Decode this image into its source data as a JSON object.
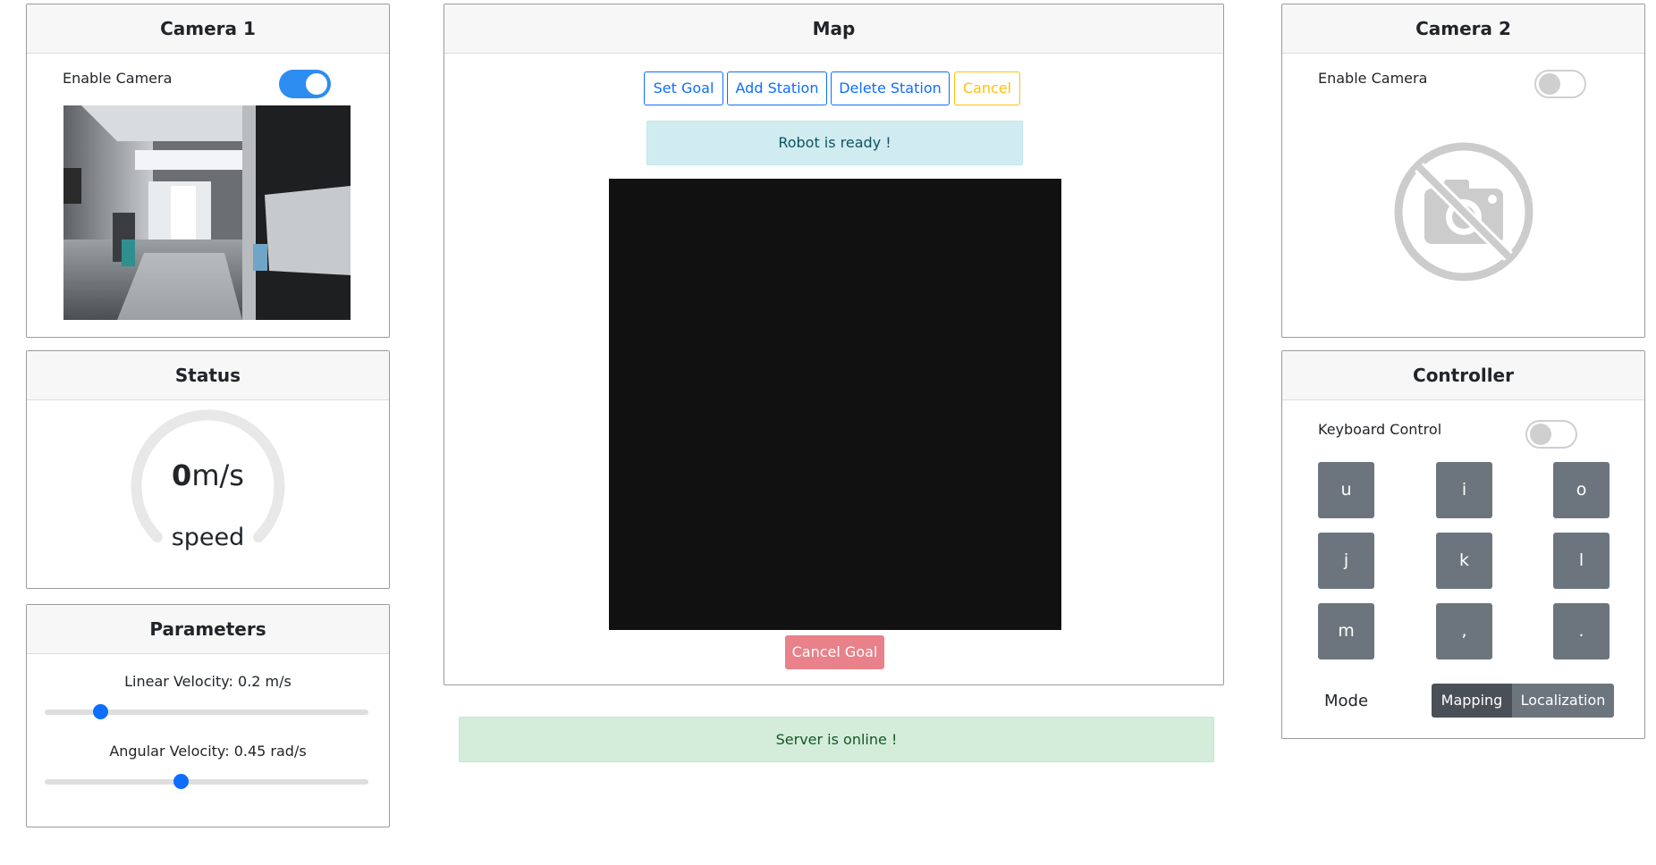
{
  "camera1": {
    "title": "Camera 1",
    "enable_label": "Enable Camera",
    "enabled": true
  },
  "status": {
    "title": "Status",
    "speed_value": "0",
    "speed_unit": "m/s",
    "speed_label": "speed"
  },
  "parameters": {
    "title": "Parameters",
    "linear_label": "Linear Velocity: 0.2 m/s",
    "linear_fraction": 0.17,
    "angular_label": "Angular Velocity: 0.45 rad/s",
    "angular_fraction": 0.42
  },
  "map": {
    "title": "Map",
    "buttons": {
      "set_goal": "Set Goal",
      "add_station": "Add Station",
      "delete_station": "Delete Station",
      "cancel": "Cancel"
    },
    "robot_status": "Robot is ready !",
    "cancel_goal": "Cancel Goal"
  },
  "server_status": "Server is online !",
  "camera2": {
    "title": "Camera 2",
    "enable_label": "Enable Camera",
    "enabled": false,
    "placeholder_icon": "no-camera-icon"
  },
  "controller": {
    "title": "Controller",
    "keyboard_label": "Keyboard Control",
    "keyboard_enabled": false,
    "keys": [
      "u",
      "i",
      "o",
      "j",
      "k",
      "l",
      "m",
      ",",
      "."
    ],
    "mode_label": "Mode",
    "modes": [
      "Mapping",
      "Localization"
    ],
    "active_mode": "Mapping"
  },
  "colors": {
    "primary": "#0d6efd",
    "toggle_on": "#2d8cf0",
    "warning": "#ffc107",
    "danger_light": "#e8818a",
    "key_gray": "#6c757d"
  }
}
